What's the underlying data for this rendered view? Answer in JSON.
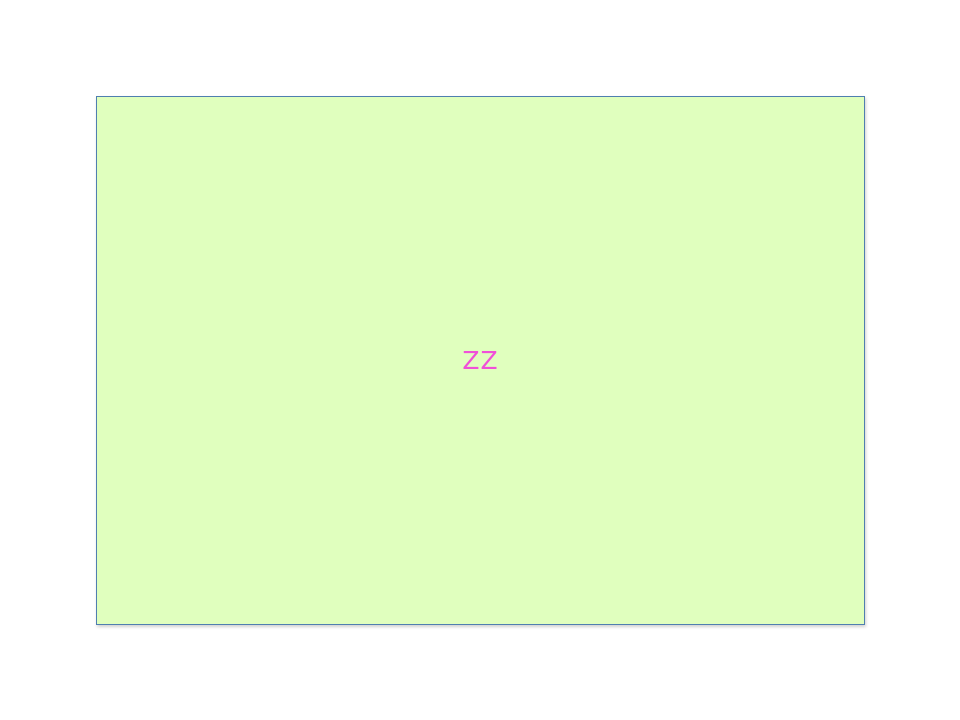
{
  "panel": {
    "text": "ZZ",
    "background_color": "#e0ffbe",
    "text_color": "#f050d8"
  }
}
